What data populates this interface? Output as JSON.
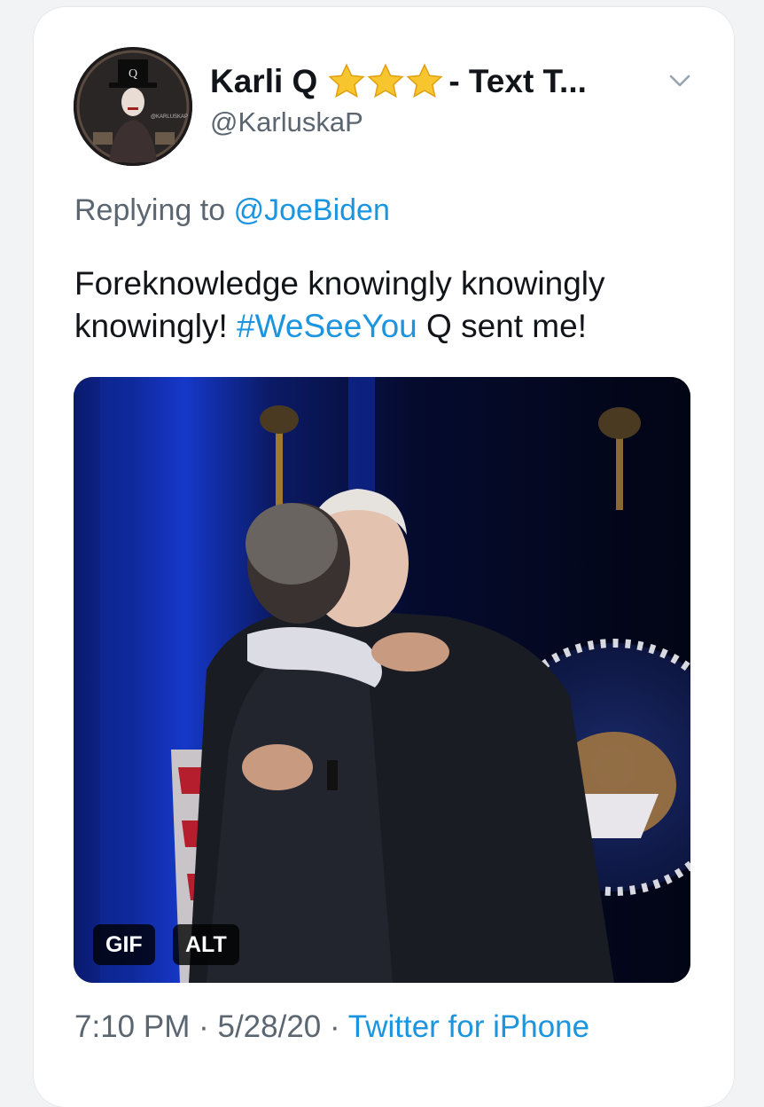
{
  "tweet": {
    "display_name": "Karli Q",
    "name_suffix": "- Text T...",
    "handle": "@KarluskaP",
    "star_count": 3,
    "reply_prefix": "Replying to",
    "reply_to": "@JoeBiden",
    "text_part1": "Foreknowledge knowingly knowingly knowingly!",
    "hashtag": "#WeSeeYou",
    "text_part2": "Q sent me!",
    "time": "7:10 PM",
    "separator1": "·",
    "date": "5/28/20",
    "separator2": "·",
    "source": "Twitter for iPhone",
    "avatar_text": "@KARLUSKAP"
  },
  "media": {
    "gif_label": "GIF",
    "alt_label": "ALT"
  },
  "colors": {
    "link": "#1b95e0",
    "text": "#111418",
    "secondary": "#5b6671",
    "star": "#f7c62f"
  },
  "icons": {
    "verified_stars": "star-icon",
    "more": "chevron-down-icon"
  }
}
